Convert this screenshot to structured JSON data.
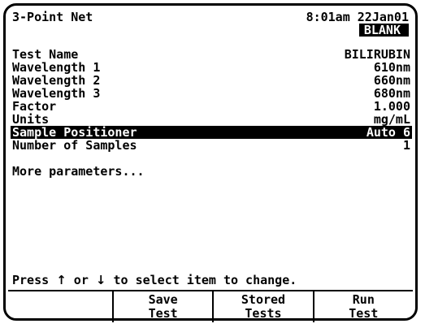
{
  "header": {
    "title": "3-Point Net",
    "time": "8:01am 22Jan01",
    "status_badge": "BLANK"
  },
  "parameters": [
    {
      "label": "Test Name",
      "value": "BILIRUBIN"
    },
    {
      "label": "Wavelength 1",
      "value": "610nm"
    },
    {
      "label": "Wavelength 2",
      "value": "660nm"
    },
    {
      "label": "Wavelength 3",
      "value": "680nm"
    },
    {
      "label": "Factor",
      "value": "1.000"
    },
    {
      "label": "Units",
      "value": "mg/mL"
    },
    {
      "label": "Sample Positioner",
      "value": "Auto 6"
    },
    {
      "label": "Number of Samples",
      "value": "1"
    }
  ],
  "selected_parameter": "Sample Positioner",
  "more_link": "More parameters...",
  "prompt": {
    "prefix": "Press ",
    "up_arrow": "↑",
    "middle": " or ",
    "down_arrow": "↓",
    "suffix": " to select item to change."
  },
  "softkeys": [
    {
      "line1": "",
      "line2": ""
    },
    {
      "line1": "Save",
      "line2": "Test"
    },
    {
      "line1": "Stored",
      "line2": "Tests"
    },
    {
      "line1": "Run",
      "line2": "Test"
    }
  ]
}
